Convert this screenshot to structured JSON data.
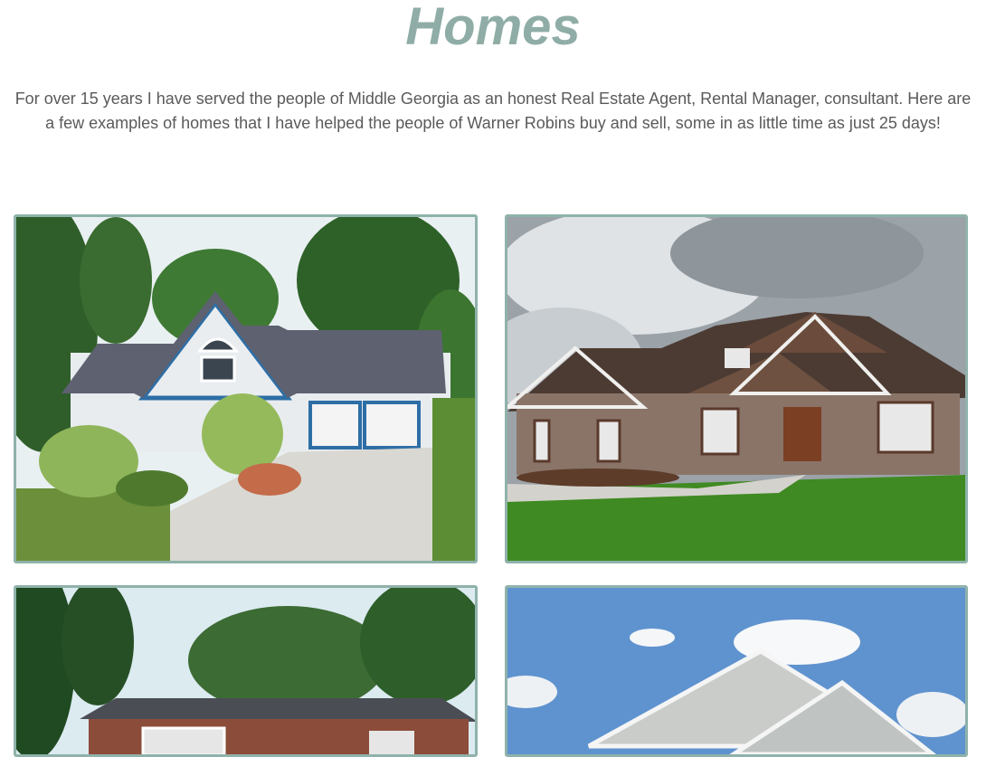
{
  "page": {
    "title": "Homes",
    "intro": "For over 15 years I have served the people of Middle Georgia as an honest Real Estate Agent, Rental Manager, consultant. Here are a few examples of homes that I have helped the people of Warner Robins buy and sell, some in as little time as just 25 days!"
  },
  "gallery": {
    "accent_border": "#8fb2aa",
    "items": [
      {
        "icon": "house-photo"
      },
      {
        "icon": "house-photo"
      },
      {
        "icon": "house-photo"
      },
      {
        "icon": "house-photo"
      }
    ]
  }
}
